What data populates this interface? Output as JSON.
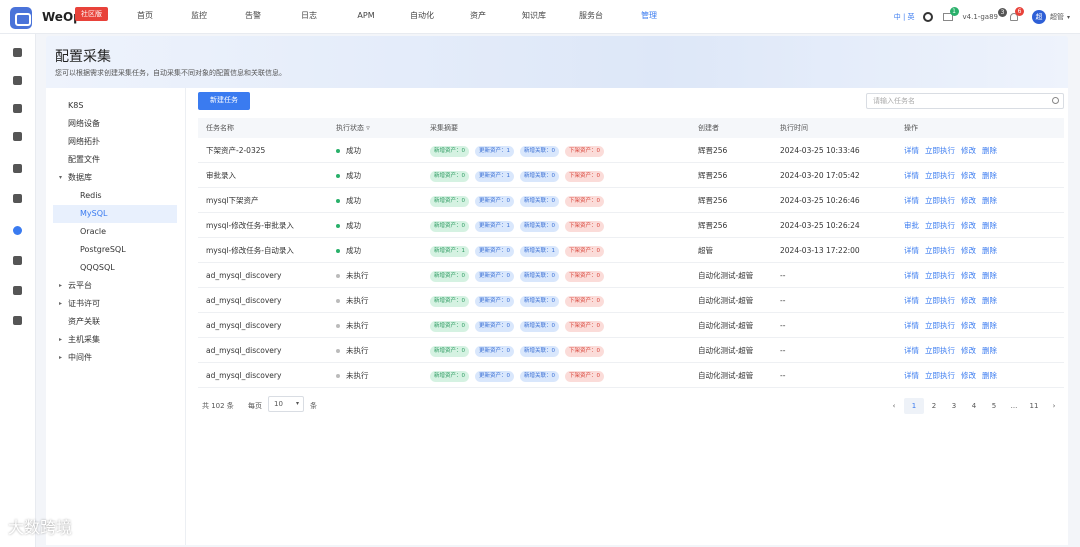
{
  "app": {
    "brand": "WeOps",
    "brand_tag": "社区版",
    "nav": [
      "首页",
      "监控",
      "告警",
      "日志",
      "APM",
      "自动化",
      "资产",
      "知识库",
      "服务台",
      "管理"
    ],
    "nav_active": 9,
    "lang": "中 | 英",
    "notify_count": "1",
    "version": "v4.1-ga89",
    "ver_badge": "3",
    "bell_count": "6",
    "avatar": "超",
    "user": "超管"
  },
  "sidebar": {
    "icons": [
      "app-icon",
      "monitor-icon",
      "alarm-icon",
      "log-icon",
      "apm-icon",
      "auto-icon",
      "asset-icon",
      "kb-icon",
      "ticket-icon",
      "settings-icon"
    ]
  },
  "page": {
    "title": "配置采集",
    "subtitle": "您可以根据需求创建采集任务，自动采集不同对象的配置信息和关联信息。"
  },
  "tree": [
    {
      "label": "K8S",
      "level": 0
    },
    {
      "label": "网络设备",
      "level": 0
    },
    {
      "label": "网络拓扑",
      "level": 0
    },
    {
      "label": "配置文件",
      "level": 0
    },
    {
      "label": "数据库",
      "level": 0,
      "arrow": "▾"
    },
    {
      "label": "Redis",
      "level": 1
    },
    {
      "label": "MySQL",
      "level": 1,
      "active": true
    },
    {
      "label": "Oracle",
      "level": 1
    },
    {
      "label": "PostgreSQL",
      "level": 1
    },
    {
      "label": "QQQSQL",
      "level": 1
    },
    {
      "label": "云平台",
      "level": 0,
      "arrow": "▸"
    },
    {
      "label": "证书许可",
      "level": 0,
      "arrow": "▸"
    },
    {
      "label": "资产关联",
      "level": 0
    },
    {
      "label": "主机采集",
      "level": 0,
      "arrow": "▸"
    },
    {
      "label": "中间件",
      "level": 0,
      "arrow": "▸"
    }
  ],
  "toolbar": {
    "new_task": "新建任务",
    "search_placeholder": "请输入任务名"
  },
  "table": {
    "headers": [
      "任务名称",
      "执行状态",
      "采集摘要",
      "创建者",
      "执行时间",
      "操作"
    ],
    "rows": [
      {
        "name": "下架资产-2-0325",
        "status": "成功",
        "ok": true,
        "tags": [
          "新增资产：0",
          "更新资产：1",
          "新增关联：0",
          "下架资产：0"
        ],
        "creator": "辉晋256",
        "time": "2024-03-25 10:33:46",
        "ops": [
          "详情",
          "立即执行",
          "修改",
          "删除"
        ]
      },
      {
        "name": "审批录入",
        "status": "成功",
        "ok": true,
        "tags": [
          "新增资产：0",
          "更新资产：1",
          "新增关联：0",
          "下架资产：0"
        ],
        "creator": "辉晋256",
        "time": "2024-03-20 17:05:42",
        "ops": [
          "详情",
          "立即执行",
          "修改",
          "删除"
        ]
      },
      {
        "name": "mysql下架资产",
        "status": "成功",
        "ok": true,
        "tags": [
          "新增资产：0",
          "更新资产：0",
          "新增关联：0",
          "下架资产：0"
        ],
        "creator": "辉晋256",
        "time": "2024-03-25 10:26:46",
        "ops": [
          "详情",
          "立即执行",
          "修改",
          "删除"
        ]
      },
      {
        "name": "mysql-修改任务-审批录入",
        "status": "成功",
        "ok": true,
        "tags": [
          "新增资产：0",
          "更新资产：1",
          "新增关联：0",
          "下架资产：0"
        ],
        "creator": "辉晋256",
        "time": "2024-03-25 10:26:24",
        "ops": [
          "审批",
          "立即执行",
          "修改",
          "删除"
        ]
      },
      {
        "name": "mysql-修改任务-自动录入",
        "status": "成功",
        "ok": true,
        "tags": [
          "新增资产：1",
          "更新资产：0",
          "新增关联：1",
          "下架资产：0"
        ],
        "creator": "超管",
        "time": "2024-03-13 17:22:00",
        "ops": [
          "详情",
          "立即执行",
          "修改",
          "删除"
        ]
      },
      {
        "name": "ad_mysql_discovery",
        "status": "未执行",
        "ok": false,
        "tags": [
          "新增资产：0",
          "更新资产：0",
          "新增关联：0",
          "下架资产：0"
        ],
        "creator": "自动化测试-超管",
        "time": "--",
        "ops": [
          "详情",
          "立即执行",
          "修改",
          "删除"
        ]
      },
      {
        "name": "ad_mysql_discovery",
        "status": "未执行",
        "ok": false,
        "tags": [
          "新增资产：0",
          "更新资产：0",
          "新增关联：0",
          "下架资产：0"
        ],
        "creator": "自动化测试-超管",
        "time": "--",
        "ops": [
          "详情",
          "立即执行",
          "修改",
          "删除"
        ]
      },
      {
        "name": "ad_mysql_discovery",
        "status": "未执行",
        "ok": false,
        "tags": [
          "新增资产：0",
          "更新资产：0",
          "新增关联：0",
          "下架资产：0"
        ],
        "creator": "自动化测试-超管",
        "time": "--",
        "ops": [
          "详情",
          "立即执行",
          "修改",
          "删除"
        ]
      },
      {
        "name": "ad_mysql_discovery",
        "status": "未执行",
        "ok": false,
        "tags": [
          "新增资产：0",
          "更新资产：0",
          "新增关联：0",
          "下架资产：0"
        ],
        "creator": "自动化测试-超管",
        "time": "--",
        "ops": [
          "详情",
          "立即执行",
          "修改",
          "删除"
        ]
      },
      {
        "name": "ad_mysql_discovery",
        "status": "未执行",
        "ok": false,
        "tags": [
          "新增资产：0",
          "更新资产：0",
          "新增关联：0",
          "下架资产：0"
        ],
        "creator": "自动化测试-超管",
        "time": "--",
        "ops": [
          "详情",
          "立即执行",
          "修改",
          "删除"
        ]
      }
    ]
  },
  "pager": {
    "total": "共 102 条",
    "per_label": "每页",
    "per_value": "10",
    "unit": "条",
    "pages": [
      "‹",
      "1",
      "2",
      "3",
      "4",
      "5",
      "...",
      "11",
      "›"
    ],
    "current": "1"
  },
  "watermark": "大数跨境",
  "colors": {
    "accent": "#3a7bf0",
    "success": "#29b06a",
    "pending": "#bbbbbb"
  }
}
